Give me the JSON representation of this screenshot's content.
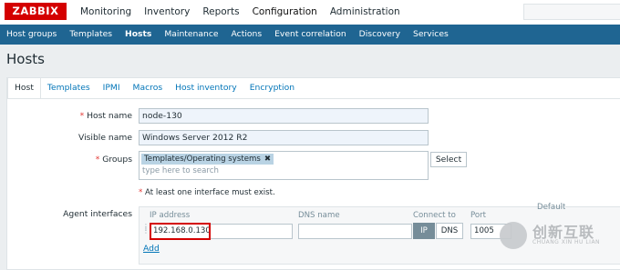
{
  "brand": {
    "logo_text": "ZABBIX",
    "accent_color": "#d40000",
    "nav_color": "#1f6592"
  },
  "main_menu": [
    {
      "label": "Monitoring"
    },
    {
      "label": "Inventory"
    },
    {
      "label": "Reports"
    },
    {
      "label": "Configuration",
      "active": true
    },
    {
      "label": "Administration"
    }
  ],
  "sub_menu": [
    {
      "label": "Host groups"
    },
    {
      "label": "Templates"
    },
    {
      "label": "Hosts",
      "active": true
    },
    {
      "label": "Maintenance"
    },
    {
      "label": "Actions"
    },
    {
      "label": "Event correlation"
    },
    {
      "label": "Discovery"
    },
    {
      "label": "Services"
    }
  ],
  "page": {
    "title": "Hosts"
  },
  "tabs": [
    {
      "label": "Host",
      "active": true
    },
    {
      "label": "Templates"
    },
    {
      "label": "IPMI"
    },
    {
      "label": "Macros"
    },
    {
      "label": "Host inventory"
    },
    {
      "label": "Encryption"
    }
  ],
  "form": {
    "required_mark": "*",
    "host_name": {
      "label": "Host name",
      "value": "node-130"
    },
    "visible_name": {
      "label": "Visible name",
      "value": "Windows Server 2012 R2"
    },
    "groups": {
      "label": "Groups",
      "selected": "Templates/Operating systems",
      "remove_glyph": "✖",
      "placeholder": "type here to search",
      "select_button": "Select"
    },
    "interface_warning": "At least one interface must exist.",
    "agent_interfaces": {
      "label": "Agent interfaces",
      "columns": {
        "ip": "IP address",
        "dns": "DNS name",
        "connect_to": "Connect to",
        "port": "Port",
        "default": "Default"
      },
      "row": {
        "ip": "192.168.0.130",
        "dns": "",
        "connect_ip": "IP",
        "connect_dns": "DNS",
        "port": "1005",
        "drag_icon": "drag-handle-icon"
      },
      "add_link": "Add"
    }
  },
  "watermark": {
    "text": "创新互联",
    "subtext": "CHUANG XIN HU LIAN",
    "icon": "logo-mark-icon"
  }
}
